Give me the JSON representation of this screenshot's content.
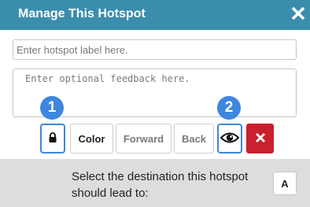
{
  "dialog": {
    "title": "Manage This Hotspot",
    "close_icon": "close-x-icon",
    "header_color": "#3a8dad"
  },
  "form": {
    "label_placeholder": "Enter hotspot label here.",
    "label_value": "",
    "feedback_placeholder": "Enter optional feedback here.",
    "feedback_value": ""
  },
  "callouts": {
    "badge_1": "1",
    "badge_2": "2",
    "color": "#3f86de"
  },
  "toolbar": {
    "lock_icon": "lock-icon",
    "color_label": "Color",
    "forward_label": "Forward",
    "back_label": "Back",
    "visibility_icon": "eye-icon",
    "delete_icon": "delete-x-icon",
    "delete_color": "#c9202d"
  },
  "footer": {
    "destination_text": "Select the destination this hotspot should lead to:",
    "destination_button_label": "A"
  }
}
